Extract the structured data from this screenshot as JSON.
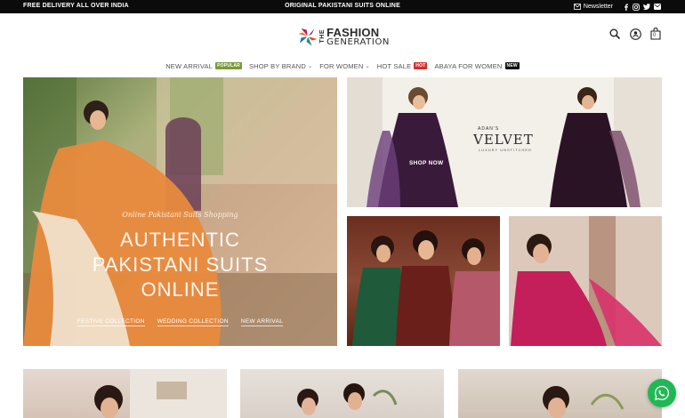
{
  "topbar": {
    "left_text": "FREE DELIVERY ALL OVER INDIA",
    "center_text": "ORIGINAL PAKISTANI SUITS ONLINE",
    "newsletter_label": "Newsletter",
    "icons": [
      "mail-icon",
      "facebook-icon",
      "instagram-icon",
      "twitter-icon",
      "email-icon"
    ]
  },
  "header": {
    "logo": {
      "the": "THE",
      "line1": "FASHION",
      "line2": "GENERATION"
    },
    "cart_count": "0",
    "icons": [
      "search-icon",
      "account-icon",
      "cart-icon"
    ]
  },
  "nav": {
    "items": [
      {
        "label": "NEW ARRIVAL",
        "badge": "POPULAR",
        "badge_color": "#7a9a3a"
      },
      {
        "label": "SHOP BY BRAND",
        "dropdown": true
      },
      {
        "label": "FOR WOMEN",
        "dropdown": true
      },
      {
        "label": "HOT SALE",
        "badge": "HOT",
        "badge_color": "#d32f2f"
      },
      {
        "label": "ABAYA FOR WOMEN",
        "badge": "NEW",
        "badge_color": "#111111"
      }
    ]
  },
  "hero": {
    "script": "Online Pakistani Suits Shopping",
    "line1": "AUTHENTIC",
    "line2": "PAKISTANI SUITS",
    "line3": "ONLINE",
    "links": [
      "FESTIVE COLLECTION",
      "WEDDING COLLECTION",
      "NEW ARRIVAL"
    ]
  },
  "velvet_banner": {
    "brand": "ADAN'S",
    "title": "VELVET",
    "subtitle": "LUXURY UNSTITCHED",
    "cta": "SHOP NOW"
  },
  "whatsapp": {
    "color": "#1fb855"
  }
}
